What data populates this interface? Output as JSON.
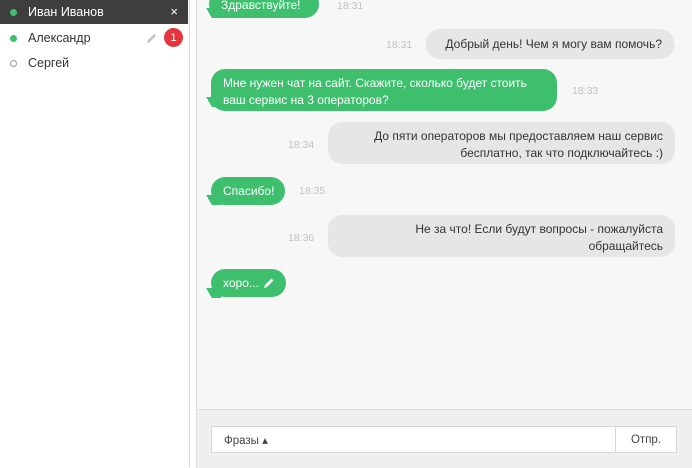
{
  "contacts": [
    {
      "name": "Иван Иванов",
      "status": "online",
      "active": true,
      "close_label": "×"
    },
    {
      "name": "Александр",
      "status": "online",
      "active": false,
      "badge": "1"
    },
    {
      "name": "Сергей",
      "status": "offline",
      "active": false
    }
  ],
  "messages": [
    {
      "direction": "out",
      "text": "Здравствуйте!",
      "time": "18:31"
    },
    {
      "direction": "in",
      "text": "Добрый день! Чем я могу вам помочь?",
      "time": "18:31"
    },
    {
      "direction": "out",
      "text": "Мне нужен чат на сайт. Скажите, сколько будет стоить ваш сервис на 3 операторов?",
      "time": "18:33"
    },
    {
      "direction": "in",
      "text": "До пяти операторов мы предоставляем наш сервис бесплатно, так что подключайтесь :)",
      "time": "18:34"
    },
    {
      "direction": "out",
      "text": "Спасибо!",
      "time": "18:35"
    },
    {
      "direction": "in",
      "text": "Не за что! Если будут вопросы - пожалуйста обращайтесь",
      "time": "18:36"
    },
    {
      "direction": "out",
      "text": "хоро...",
      "typing": true
    }
  ],
  "footer": {
    "phrases_label": "Фразы ▴",
    "send_label": "Отпр."
  },
  "colors": {
    "accent_green": "#3dbf6e",
    "active_contact_bg": "#3e3e3e",
    "badge_red": "#e5363d",
    "incoming_bubble": "#e6e6e6"
  },
  "icons": [
    "status-dot-icon",
    "close-icon",
    "pencil-icon"
  ]
}
